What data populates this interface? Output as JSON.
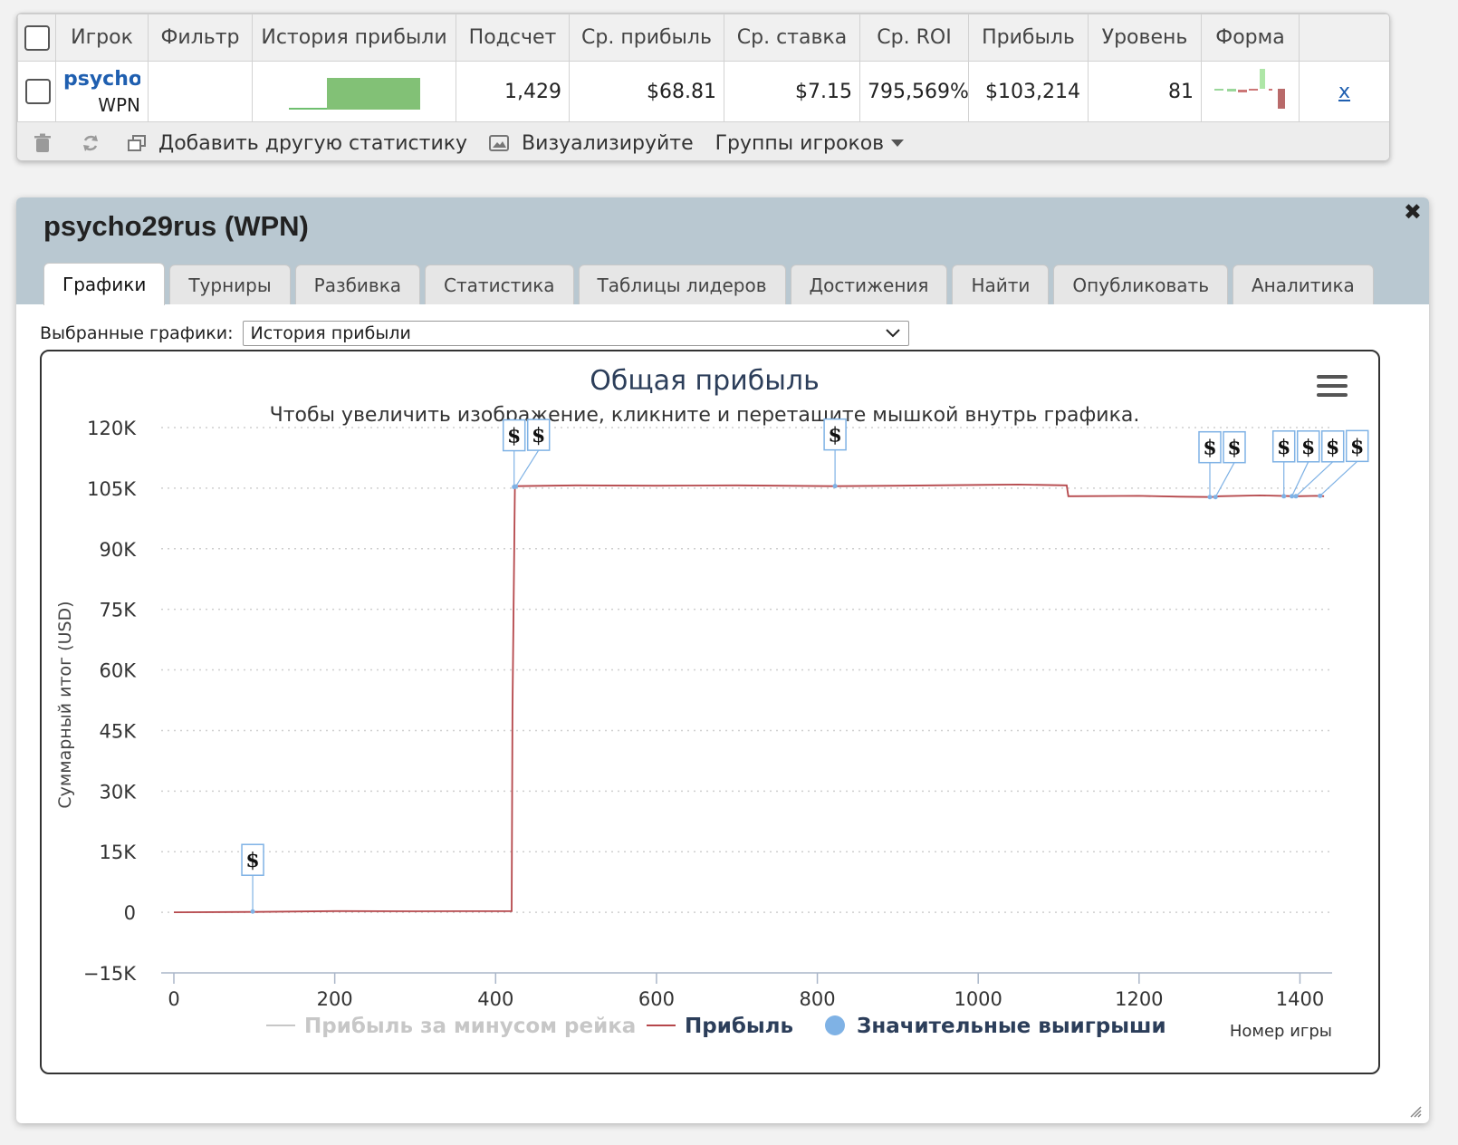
{
  "stats": {
    "headers": [
      "Игрок",
      "Фильтр",
      "История прибыли",
      "Подсчет",
      "Ср. прибыль",
      "Ср. ставка",
      "Ср. ROI",
      "Прибыль",
      "Уровень",
      "Форма"
    ],
    "row": {
      "player_name": "psycho29rus",
      "site": "WPN",
      "count": "1,429",
      "avg_profit": "$68.81",
      "avg_stake": "$7.15",
      "avg_roi": "795,569%",
      "profit": "$103,214",
      "level": "81",
      "remove": "x"
    },
    "toolbar": {
      "add_stat": "Добавить другую статистику",
      "visualize": "Визуализируйте",
      "player_groups": "Группы игроков"
    }
  },
  "panel": {
    "title": "psycho29rus (WPN)",
    "tabs": [
      "Графики",
      "Турниры",
      "Разбивка",
      "Статистика",
      "Таблицы лидеров",
      "Достижения",
      "Найти",
      "Опубликовать",
      "Аналитика"
    ],
    "active_tab": 0,
    "selected_label": "Выбранные графики:",
    "selected_value": "История прибыли"
  },
  "colors": {
    "profit_line": "#b5474b",
    "rake_line": "#c7c7c7",
    "big_win": "#7fb2e5",
    "accent": "#1f5fb0"
  },
  "chart_data": {
    "type": "line",
    "title": "Общая прибыль",
    "subtitle": "Чтобы увеличить изображение, кликните и перетащите мышкой внутрь графика.",
    "xlabel": "Номер игры",
    "ylabel": "Суммарный итог (USD)",
    "xlim": [
      0,
      1440
    ],
    "ylim": [
      -15000,
      120000
    ],
    "x_ticks": [
      0,
      200,
      400,
      600,
      800,
      1000,
      1200,
      1400
    ],
    "y_ticks": [
      -15000,
      0,
      15000,
      30000,
      45000,
      60000,
      75000,
      90000,
      105000,
      120000
    ],
    "y_tick_labels": [
      "−15K",
      "0",
      "15K",
      "30K",
      "45K",
      "60K",
      "75K",
      "90K",
      "105K",
      "120K"
    ],
    "grid": "horizontal-dotted",
    "legend_position": "bottom",
    "series": [
      {
        "name": "Прибыль за минусом рейка",
        "values": []
      },
      {
        "name": "Прибыль",
        "x": [
          0,
          100,
          200,
          300,
          420,
          421,
          424,
          500,
          600,
          700,
          820,
          900,
          1000,
          1050,
          1110,
          1112,
          1200,
          1250,
          1290,
          1300,
          1350,
          1395,
          1420,
          1430
        ],
        "y": [
          0,
          100,
          300,
          250,
          300,
          50000,
          105500,
          105700,
          105600,
          105700,
          105500,
          105600,
          105800,
          105900,
          105700,
          103000,
          103100,
          102900,
          102800,
          103000,
          103200,
          103000,
          103100,
          103000
        ]
      },
      {
        "name": "Значительные выигрыши",
        "x": [
          98,
          423,
          425,
          822,
          1288,
          1295,
          1380,
          1390,
          1395,
          1425
        ],
        "y": [
          200,
          105300,
          105400,
          105500,
          102800,
          102800,
          103000,
          103000,
          103000,
          103100
        ],
        "flag": "$"
      }
    ]
  }
}
